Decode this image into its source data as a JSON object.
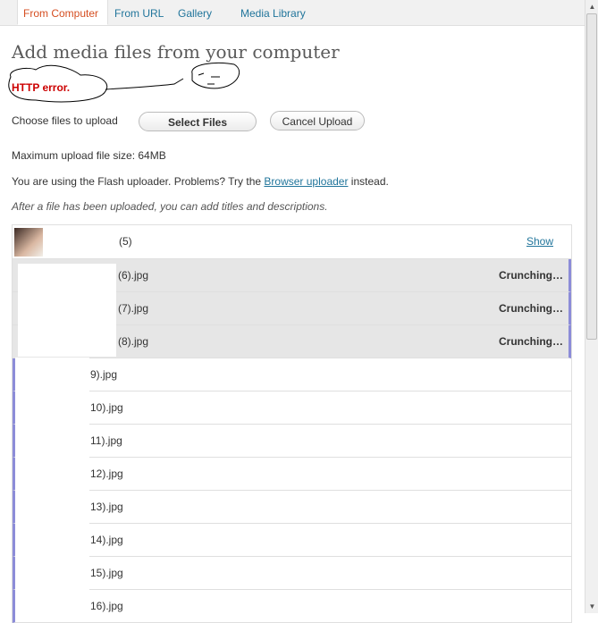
{
  "tabs": [
    {
      "label": "From Computer",
      "active": true
    },
    {
      "label": "From URL"
    },
    {
      "label": "Gallery"
    },
    {
      "label": "Media Library"
    }
  ],
  "page_title": "Add media files from your computer",
  "annotation_text": "HTTP error.",
  "upload": {
    "choose_label": "Choose files to upload",
    "select_button": "Select Files",
    "cancel_button": "Cancel Upload",
    "max_size": "Maximum upload file size: 64MB",
    "flash_prefix": "You are using the Flash uploader. Problems? Try the ",
    "flash_link": "Browser uploader",
    "flash_suffix": " instead.",
    "hint": "After a file has been uploaded, you can add titles and descriptions."
  },
  "files": [
    {
      "name": "(5)",
      "action": "Show",
      "state": "done"
    },
    {
      "name": "(6).jpg",
      "status": "Crunching…",
      "state": "crunching"
    },
    {
      "name": "(7).jpg",
      "status": "Crunching…",
      "state": "crunching"
    },
    {
      "name": "(8).jpg",
      "status": "Crunching…",
      "state": "crunching"
    },
    {
      "name": "9).jpg",
      "state": "queued"
    },
    {
      "name": "10).jpg",
      "state": "queued"
    },
    {
      "name": "11).jpg",
      "state": "queued"
    },
    {
      "name": "12).jpg",
      "state": "queued"
    },
    {
      "name": "13).jpg",
      "state": "queued"
    },
    {
      "name": "14).jpg",
      "state": "queued"
    },
    {
      "name": "15).jpg",
      "state": "queued"
    },
    {
      "name": "16).jpg",
      "state": "queued"
    }
  ],
  "colors": {
    "accent": "#21759b",
    "active_tab": "#d54e21",
    "error": "#cc0000",
    "progress_bar": "#8c8cd8"
  }
}
